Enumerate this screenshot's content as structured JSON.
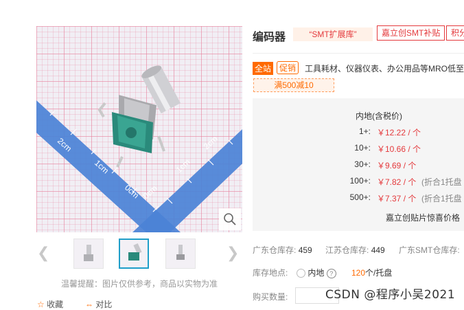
{
  "gallery": {
    "ruler_labels": [
      "2cm",
      "1cm",
      "0cm"
    ],
    "notice": "温馨提醒：图片仅供参考，商品以实物为准",
    "collect_label": "收藏",
    "compare_label": "对比"
  },
  "product": {
    "title": "编码器",
    "smt_tag": "“SMT扩展库”",
    "subsidy_tag": "嘉立创SMT补贴",
    "points_tag": "积分"
  },
  "promo": {
    "all_badge": "全站",
    "promo_badge": "促销",
    "text": "工具耗材、仪器仪表、办公用品等MRO低至",
    "coupon": "满500减10"
  },
  "pricing": {
    "header": "内地(含税价)",
    "tiers": [
      {
        "qty": "1+:",
        "price": "￥12.22 / 个",
        "note": ""
      },
      {
        "qty": "10+:",
        "price": "￥10.66 / 个",
        "note": ""
      },
      {
        "qty": "30+:",
        "price": "￥9.69 / 个",
        "note": ""
      },
      {
        "qty": "100+:",
        "price": "￥7.82 / 个",
        "note": "(折合1托盘"
      },
      {
        "qty": "500+:",
        "price": "￥7.37 / 个",
        "note": "(折合1托盘"
      }
    ],
    "reel_link": "嘉立创贴片惊喜价格"
  },
  "stock": {
    "guangdong_label": "广东仓库存:",
    "guangdong_value": "459",
    "jiangsu_label": "江苏仓库存:",
    "jiangsu_value": "449",
    "smt_label": "广东SMT仓库存:"
  },
  "location": {
    "label": "库存地点:",
    "option": "内地",
    "help": "?",
    "per_tray_value": "120",
    "per_tray_unit": "个/托盘"
  },
  "quantity": {
    "label": "购买数量:",
    "value": ""
  },
  "watermark": "CSDN @程序小吴2021"
}
